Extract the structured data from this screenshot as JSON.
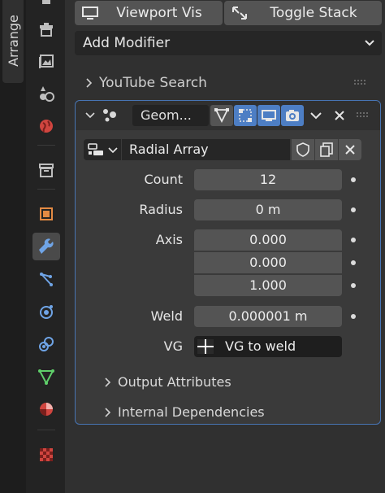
{
  "left_strip": {
    "tab_label": "Arrange"
  },
  "top_buttons": {
    "viewport_vis": "Viewport Vis",
    "toggle_stack": "Toggle Stack"
  },
  "add_modifier": {
    "label": "Add Modifier"
  },
  "panel_youtube": {
    "label": "YouTube Search"
  },
  "modifier": {
    "name": "Geom...",
    "node_group": "Radial Array",
    "fields": {
      "count": {
        "label": "Count",
        "value": "12"
      },
      "radius": {
        "label": "Radius",
        "value": "0 m"
      },
      "axis": {
        "label": "Axis",
        "values": [
          "0.000",
          "0.000",
          "1.000"
        ]
      },
      "weld": {
        "label": "Weld",
        "value": "0.000001 m"
      },
      "vg": {
        "label": "VG",
        "value": "VG to weld"
      }
    },
    "subpanels": [
      "Output Attributes",
      "Internal Dependencies"
    ]
  },
  "colors": {
    "accent": "#4774b3",
    "active_toggle": "#4d7ec4",
    "field": "#545454"
  },
  "icons": {
    "tabs": [
      "tool-icon",
      "render-icon",
      "output-icon",
      "view-layer-icon",
      "scene-icon",
      "world-icon",
      "collection-icon",
      "object-icon",
      "modifier-icon",
      "particles-icon",
      "physics-icon",
      "constraints-icon",
      "data-icon",
      "material-icon",
      "texture-icon"
    ]
  }
}
